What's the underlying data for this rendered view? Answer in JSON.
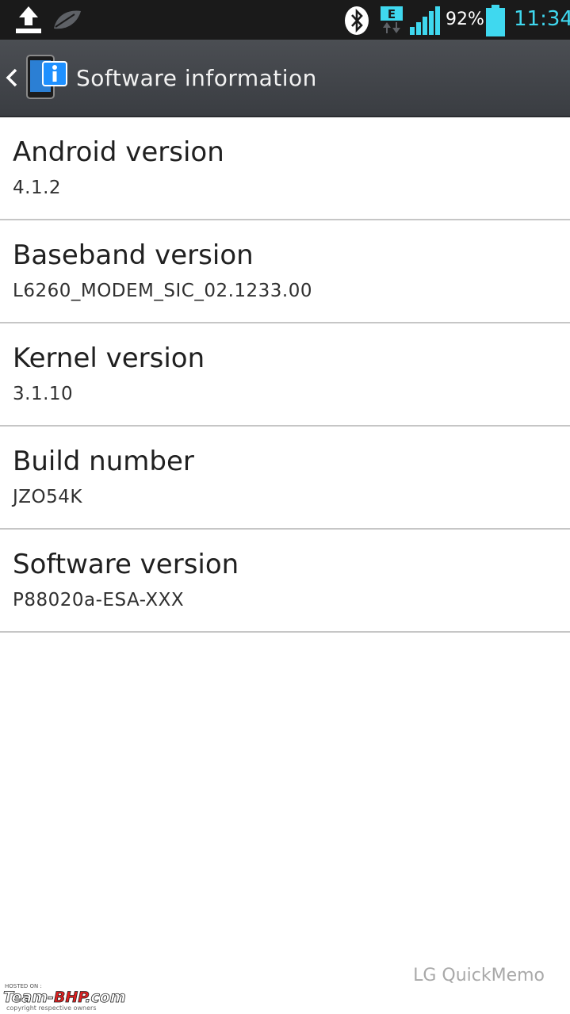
{
  "status_bar": {
    "battery_percent": "92%",
    "time": "11:34",
    "network_type": "E",
    "icons": [
      "upload-icon",
      "leaf-icon",
      "bluetooth-icon",
      "edge-data-icon",
      "signal-icon",
      "battery-icon"
    ]
  },
  "action_bar": {
    "title": "Software information"
  },
  "items": [
    {
      "label": "Android version",
      "value": "4.1.2"
    },
    {
      "label": "Baseband version",
      "value": "L6260_MODEM_SIC_02.1233.00"
    },
    {
      "label": "Kernel version",
      "value": "3.1.10"
    },
    {
      "label": "Build number",
      "value": "JZO54K"
    },
    {
      "label": "Software version",
      "value": "P88020a-ESA-XXX"
    }
  ],
  "footer": {
    "quickmemo": "LG QuickMemo",
    "watermark_hosted": "HOSTED ON :",
    "watermark_brand": "Team-BHP.com",
    "watermark_copyright": "copyright respective owners"
  },
  "colors": {
    "status_bar_bg": "#1a1a1a",
    "action_bar_bg": "#43464b",
    "accent_cyan": "#3fd8ef",
    "divider": "#c6c6c6",
    "background": "#ffffff"
  }
}
